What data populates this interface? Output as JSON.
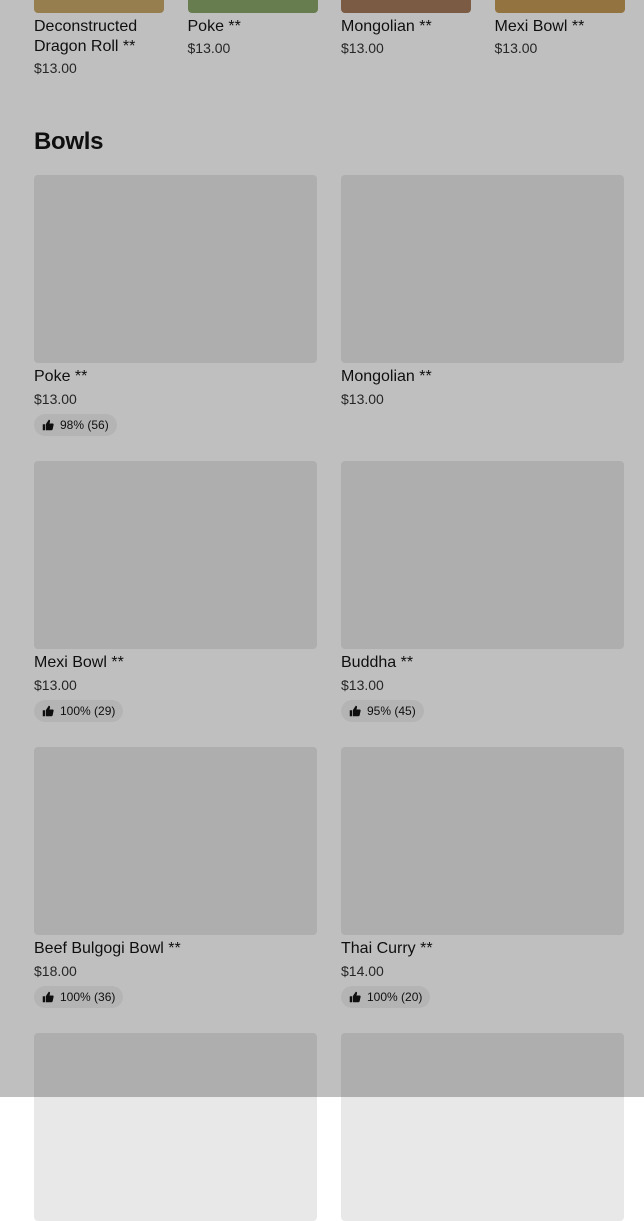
{
  "colors": {
    "overlay": "rgba(0,0,0,0.25)",
    "placeholder": "#e8e8e8"
  },
  "carousel": [
    {
      "name": "Deconstructed Dragon Roll **",
      "price": "$13.00",
      "thumb_color": "#c8a86a"
    },
    {
      "name": "Poke **",
      "price": "$13.00",
      "thumb_color": "#8aa66a"
    },
    {
      "name": "Mongolian **",
      "price": "$13.00",
      "thumb_color": "#a57a5a"
    },
    {
      "name": "Mexi Bowl **",
      "price": "$13.00",
      "thumb_color": "#c49a55"
    }
  ],
  "section": {
    "title": "Bowls"
  },
  "items": [
    {
      "name": "Poke **",
      "price": "$13.00",
      "rating": "98% (56)"
    },
    {
      "name": "Mongolian **",
      "price": "$13.00",
      "rating": ""
    },
    {
      "name": "Mexi Bowl **",
      "price": "$13.00",
      "rating": "100% (29)"
    },
    {
      "name": "Buddha **",
      "price": "$13.00",
      "rating": "95% (45)"
    },
    {
      "name": "Beef Bulgogi Bowl **",
      "price": "$18.00",
      "rating": "100% (36)"
    },
    {
      "name": "Thai Curry **",
      "price": "$14.00",
      "rating": "100% (20)"
    },
    {
      "name": "",
      "price": "",
      "rating": ""
    },
    {
      "name": "",
      "price": "",
      "rating": ""
    }
  ],
  "icons": {
    "rating": "thumbs-up-icon"
  }
}
